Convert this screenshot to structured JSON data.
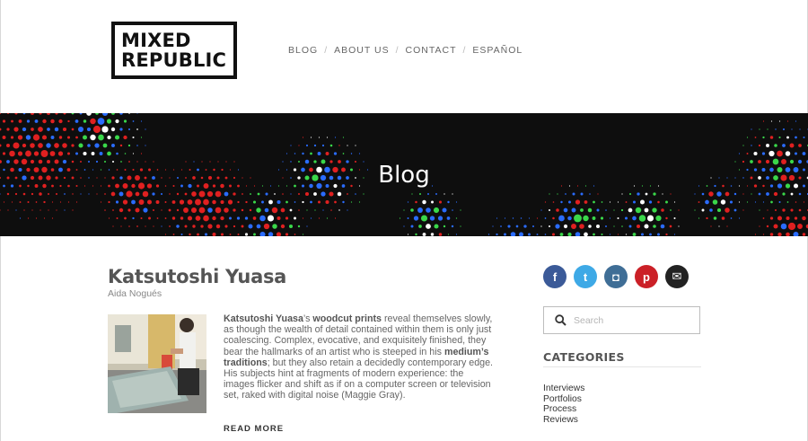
{
  "header": {
    "logo_line1": "MIXED",
    "logo_line2": "REPUBLIC",
    "nav": [
      {
        "label": "BLOG"
      },
      {
        "label": "ABOUT US"
      },
      {
        "label": "CONTACT"
      },
      {
        "label": "ESPAÑOL"
      }
    ],
    "nav_separator": "/"
  },
  "hero": {
    "title": "Blog",
    "background_color": "#0e0e0e",
    "halftone_colors": [
      "#e02020",
      "#2a6cff",
      "#3ad84a",
      "#ffffff"
    ]
  },
  "post": {
    "title": "Katsutoshi Yuasa",
    "author": "Aida Nogués",
    "thumbnail_icon": "artist-photo",
    "excerpt": {
      "lead_bold": "Katsutoshi Yuasa",
      "part1": "’s ",
      "bold2": "woodcut prints",
      "part2": " reveal themselves slowly, as though the wealth of detail contained within them is only just coalescing. Complex, evocative, and exquisitely finished, they bear the hallmarks of an artist who is steeped in his ",
      "bold3": "medium’s traditions",
      "part3": "; but they also retain a decidedly contemporary edge. His subjects hint at fragments of modern experience: the images flicker and shift as if on a computer screen or television set, raked with digital noise (Maggie Gray)."
    },
    "read_more": "READ MORE"
  },
  "sidebar": {
    "social": [
      {
        "name": "facebook",
        "glyph": "f",
        "color": "#3b5a98"
      },
      {
        "name": "twitter",
        "glyph": "t",
        "color": "#3ea9e6"
      },
      {
        "name": "instagram",
        "glyph": "◘",
        "color": "#3f6e96"
      },
      {
        "name": "pinterest",
        "glyph": "p",
        "color": "#cb2027"
      },
      {
        "name": "email",
        "glyph": "✉",
        "color": "#222222"
      }
    ],
    "search": {
      "placeholder": "Search",
      "icon": "search-icon"
    },
    "categories_heading": "CATEGORIES",
    "categories": [
      "Interviews",
      "Portfolios",
      "Process",
      "Reviews"
    ]
  }
}
